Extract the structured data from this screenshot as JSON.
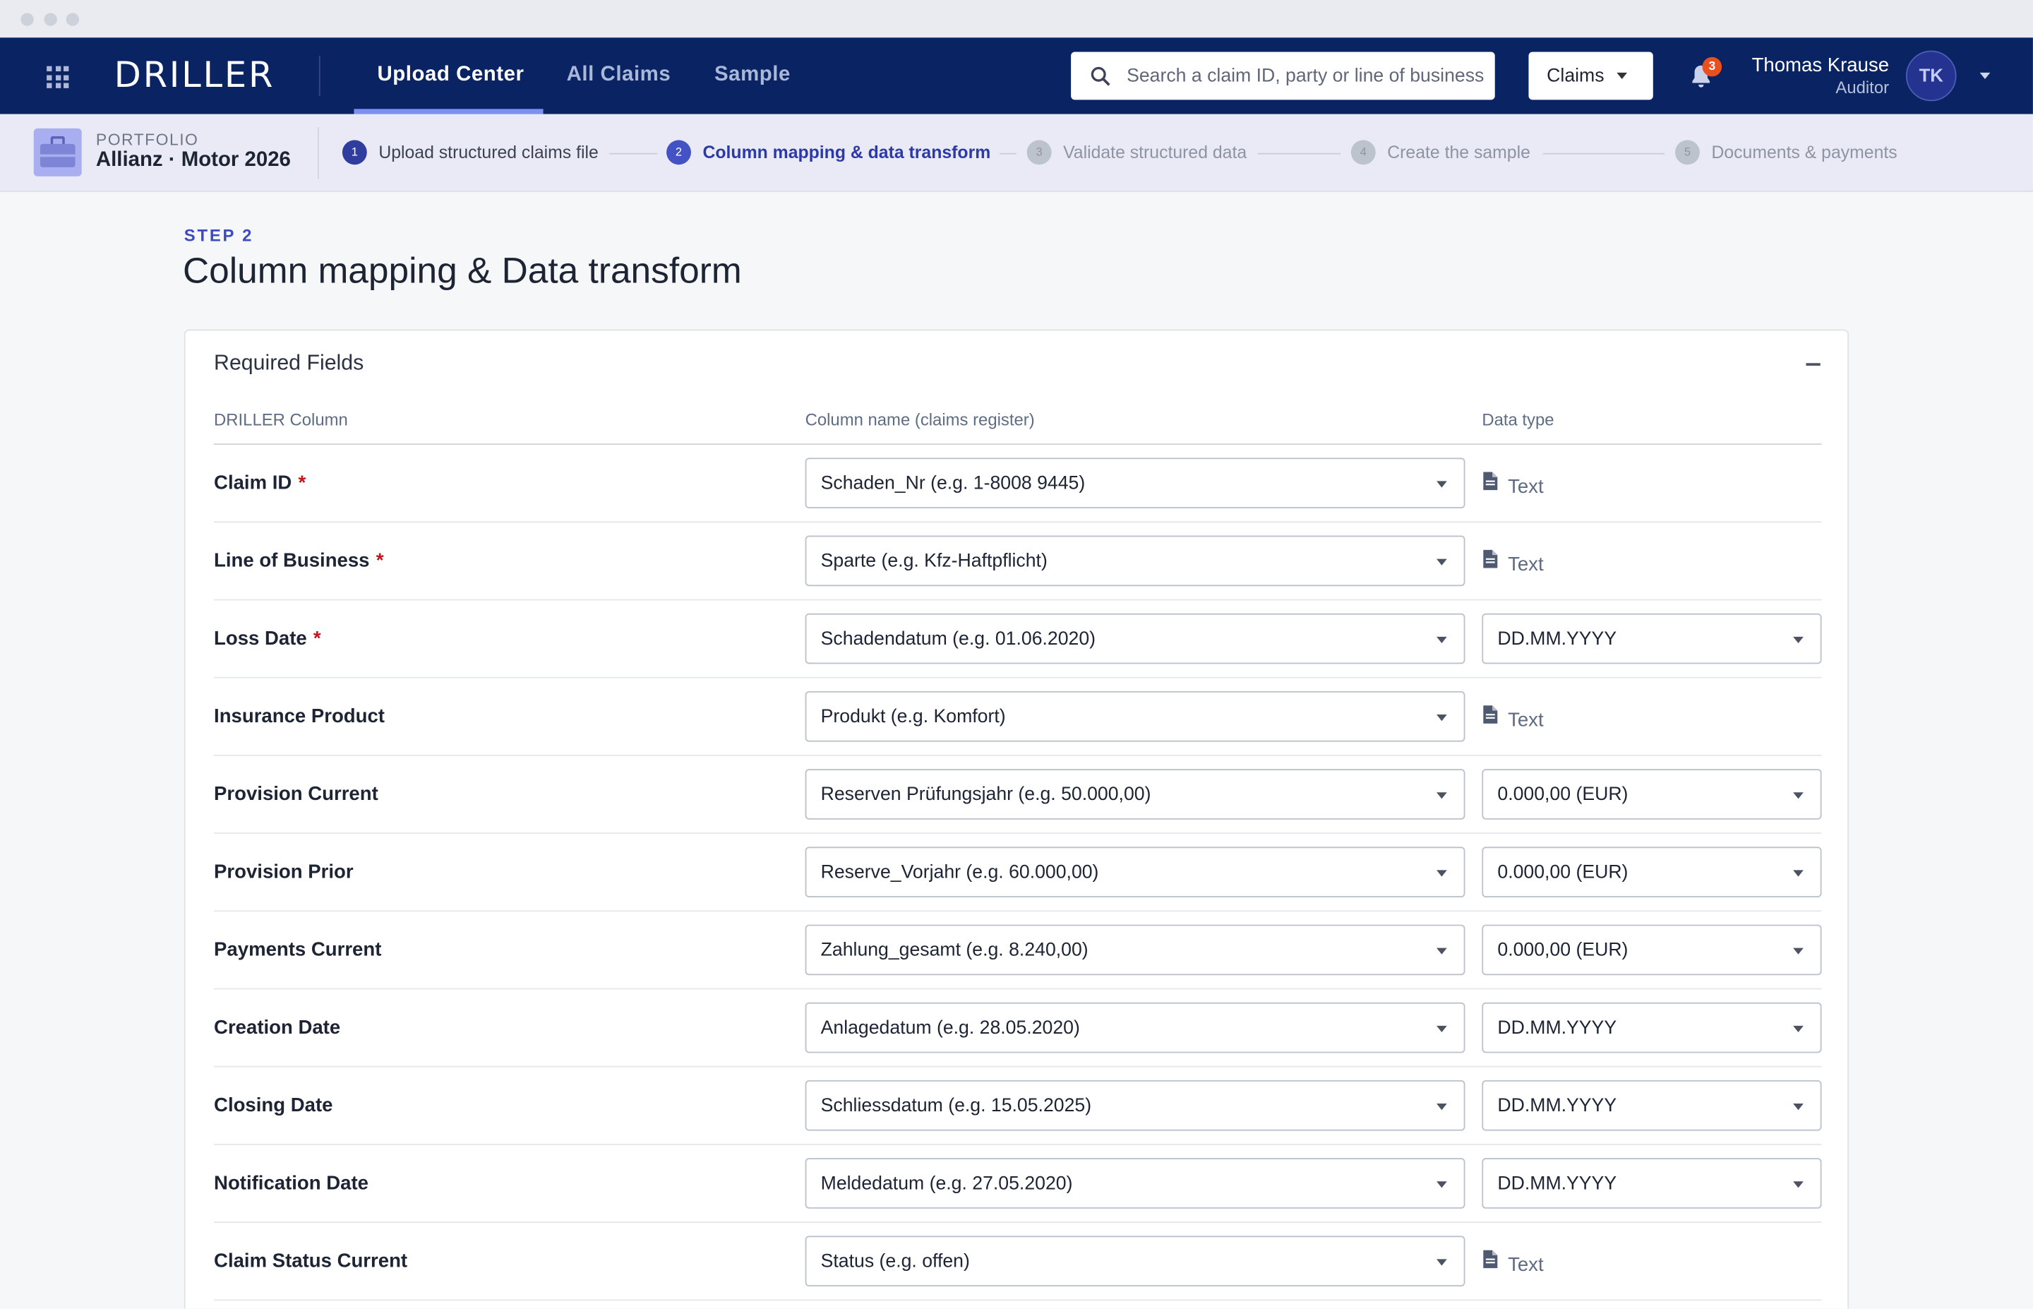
{
  "app": {
    "logo": "DRILLER",
    "nav": [
      {
        "label": "Upload Center",
        "active": true
      },
      {
        "label": "All Claims",
        "active": false
      },
      {
        "label": "Sample",
        "active": false
      }
    ],
    "search_placeholder": "Search a claim ID, party or line of business",
    "scope_select": "Claims",
    "notifications_count": "3",
    "user": {
      "name": "Thomas Krause",
      "role": "Auditor",
      "initials": "TK"
    }
  },
  "portfolio": {
    "label": "PORTFOLIO",
    "name": "Allianz · Motor 2026"
  },
  "steps": [
    {
      "num": "1",
      "label": "Upload structured claims file",
      "state": "done"
    },
    {
      "num": "2",
      "label": "Column mapping & data transform",
      "state": "active"
    },
    {
      "num": "3",
      "label": "Validate structured data",
      "state": "todo"
    },
    {
      "num": "4",
      "label": "Create the sample",
      "state": "todo"
    },
    {
      "num": "5",
      "label": "Documents & payments",
      "state": "todo"
    }
  ],
  "page": {
    "kicker": "STEP 2",
    "title": "Column mapping & Data transform"
  },
  "section": {
    "title": "Required Fields",
    "headers": {
      "driller": "DRILLER Column",
      "column": "Column name (claims register)",
      "dtype": "Data type"
    },
    "rows": [
      {
        "label": "Claim ID",
        "required": "*",
        "column": "Schaden_Nr (e.g. 1-8008 9445)",
        "dtype": "Text",
        "dtype_kind": "text"
      },
      {
        "label": "Line of Business",
        "required": "*",
        "column": "Sparte (e.g. Kfz-Haftpflicht)",
        "dtype": "Text",
        "dtype_kind": "text"
      },
      {
        "label": "Loss Date",
        "required": "*",
        "column": "Schadendatum (e.g. 01.06.2020)",
        "dtype": "DD.MM.YYYY",
        "dtype_kind": "select"
      },
      {
        "label": "Insurance Product",
        "required": "",
        "column": "Produkt (e.g. Komfort)",
        "dtype": "Text",
        "dtype_kind": "text"
      },
      {
        "label": "Provision Current",
        "required": "",
        "column": "Reserven Prüfungsjahr (e.g. 50.000,00)",
        "dtype": "0.000,00 (EUR)",
        "dtype_kind": "select"
      },
      {
        "label": "Provision Prior",
        "required": "",
        "column": "Reserve_Vorjahr (e.g. 60.000,00)",
        "dtype": "0.000,00 (EUR)",
        "dtype_kind": "select"
      },
      {
        "label": "Payments Current",
        "required": "",
        "column": "Zahlung_gesamt (e.g. 8.240,00)",
        "dtype": "0.000,00 (EUR)",
        "dtype_kind": "select"
      },
      {
        "label": "Creation Date",
        "required": "",
        "column": "Anlagedatum (e.g. 28.05.2020)",
        "dtype": "DD.MM.YYYY",
        "dtype_kind": "select"
      },
      {
        "label": "Closing Date",
        "required": "",
        "column": "Schliessdatum (e.g. 15.05.2025)",
        "dtype": "DD.MM.YYYY",
        "dtype_kind": "select"
      },
      {
        "label": "Notification Date",
        "required": "",
        "column": "Meldedatum (e.g. 27.05.2020)",
        "dtype": "DD.MM.YYYY",
        "dtype_kind": "select"
      },
      {
        "label": "Claim Status Current",
        "required": "",
        "column": "Status (e.g. offen)",
        "dtype": "Text",
        "dtype_kind": "text"
      }
    ]
  }
}
